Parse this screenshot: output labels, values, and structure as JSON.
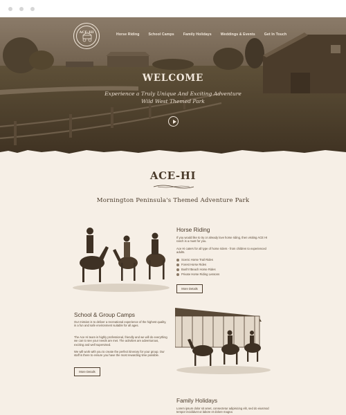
{
  "nav": {
    "logo_text": "ACE-HI",
    "items": [
      {
        "label": "Horse Riding"
      },
      {
        "label": "School Camps"
      },
      {
        "label": "Family Holidays"
      },
      {
        "label": "Weddings & Events"
      },
      {
        "label": "Get In Touch"
      }
    ]
  },
  "hero": {
    "title": "WELCOME",
    "subtitle_line1": "Experience a Truly Unique And Exciting Adventure",
    "subtitle_line2": "Wild West Themed Park"
  },
  "intro": {
    "brand": "ACE-HI",
    "tagline": "Mornington Peninsula's Themed Adventure Park"
  },
  "horse_riding": {
    "title": "Horse Riding",
    "p1": "If you would like to try or already love horse riding, then visiting ACE HI ranch is a must for you.",
    "p2": "Ace Hi caters for all type of horse riders - from children to experienced adults.",
    "bullets": [
      "Scenic Horse Trail Rides",
      "Forest Horse Rides",
      "Bush'n'Beach Horse Rides",
      "Private Horse Riding Lessons"
    ],
    "button": "More Details"
  },
  "school_camps": {
    "title": "School & Group Camps",
    "p1": "Our mission is to deliver a recreational experience of the highest quality, in a fun and safe environment suitable for all ages.",
    "p2": "The Ace Hi team is highly professional, friendly and we will do everything we can to see your needs are met. The activities are adventurous, exciting and well supervised.",
    "p3": "We will work with you to create the perfect itinerary for your group. Our staff is there to ensure you have the most rewarding time possible.",
    "button": "More Details"
  },
  "family_holidays": {
    "title": "Family Holidays",
    "p1": "Lorem ipsum dolor sit amet, consectetur adipisicing elit, sed do eiusmod tempor incididunt ut labore et dolore magna"
  }
}
